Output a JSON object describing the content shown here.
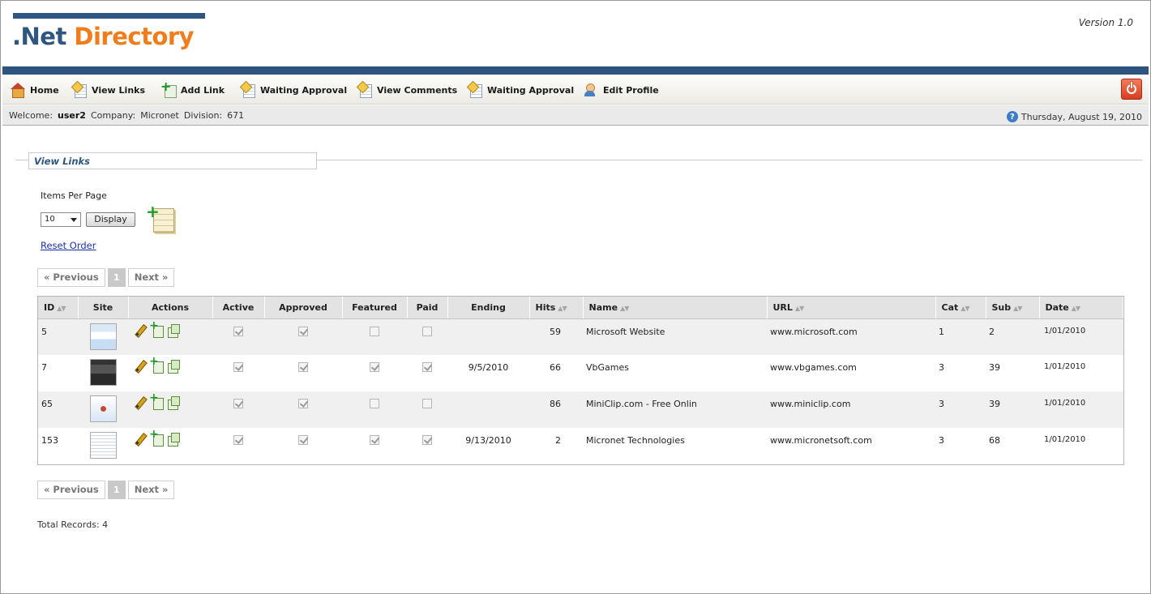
{
  "header": {
    "logo_part1": ".Net",
    "logo_part2": " Directory",
    "version": "Version 1.0"
  },
  "nav": {
    "items": [
      {
        "label": "Home",
        "icon": "home-icon"
      },
      {
        "label": "View Links",
        "icon": "document-icon"
      },
      {
        "label": "Add Link",
        "icon": "add-document-icon"
      },
      {
        "label": "Waiting Approval",
        "icon": "document-icon"
      },
      {
        "label": "View Comments",
        "icon": "document-icon"
      },
      {
        "label": "Waiting Approval",
        "icon": "document-icon"
      },
      {
        "label": "Edit Profile",
        "icon": "user-icon"
      }
    ],
    "logout_icon": "power-icon"
  },
  "welcome": {
    "welcome_label": "Welcome:",
    "user": "user2",
    "company_label": "Company:",
    "company": "Micronet",
    "division_label": "Division:",
    "division": "671",
    "date": "Thursday, August 19, 2010"
  },
  "section": {
    "title": "View Links"
  },
  "controls": {
    "items_per_page_label": "Items Per Page",
    "items_per_page_value": "10",
    "display_button": "Display",
    "reset_order": "Reset Order"
  },
  "pager": {
    "previous": "« Previous",
    "current": "1",
    "next": "Next »"
  },
  "table": {
    "columns": [
      "ID",
      "Site",
      "Actions",
      "Active",
      "Approved",
      "Featured",
      "Paid",
      "Ending",
      "Hits",
      "Name",
      "URL",
      "Cat",
      "Sub",
      "Date"
    ],
    "rows": [
      {
        "id": "5",
        "active": true,
        "approved": true,
        "featured": false,
        "paid": false,
        "ending": "",
        "hits": "59",
        "name": "Microsoft Website",
        "url": "www.microsoft.com",
        "cat": "1",
        "sub": "2",
        "date": "1/01/2010"
      },
      {
        "id": "7",
        "active": true,
        "approved": true,
        "featured": true,
        "paid": true,
        "ending": "9/5/2010",
        "hits": "66",
        "name": "VbGames",
        "url": "www.vbgames.com",
        "cat": "3",
        "sub": "39",
        "date": "1/01/2010"
      },
      {
        "id": "65",
        "active": true,
        "approved": true,
        "featured": false,
        "paid": false,
        "ending": "",
        "hits": "86",
        "name": "MiniClip.com - Free Onlin",
        "url": "www.miniclip.com",
        "cat": "3",
        "sub": "39",
        "date": "1/01/2010"
      },
      {
        "id": "153",
        "active": true,
        "approved": true,
        "featured": true,
        "paid": true,
        "ending": "9/13/2010",
        "hits": "2",
        "name": "Micronet Technologies",
        "url": "www.micronetsoft.com",
        "cat": "3",
        "sub": "68",
        "date": "1/01/2010"
      }
    ]
  },
  "footer": {
    "total_records": "Total Records: 4"
  }
}
